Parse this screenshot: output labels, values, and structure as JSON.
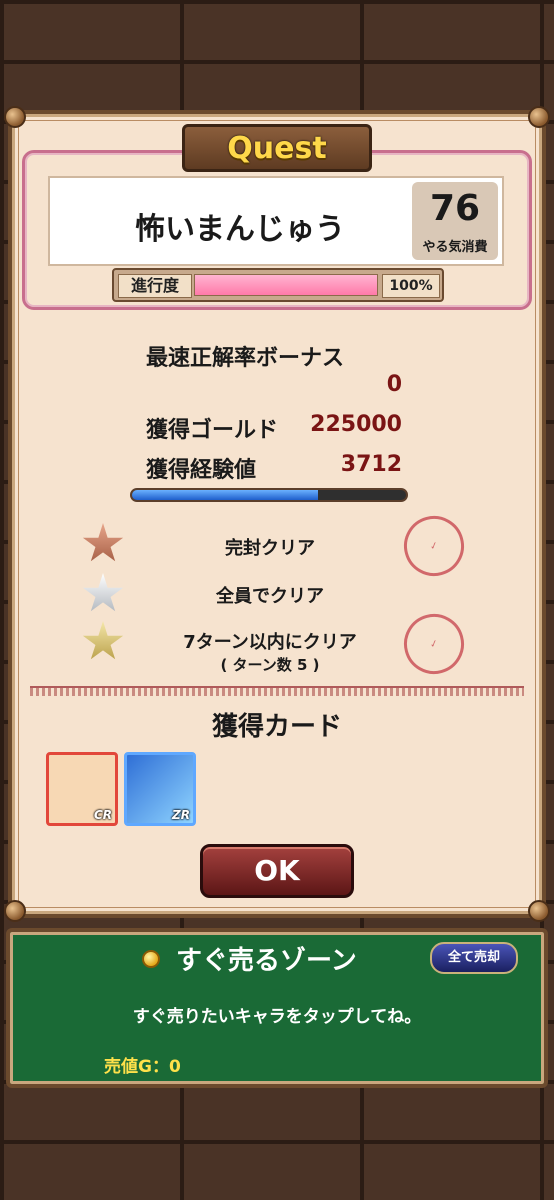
{
  "header": {
    "title": "Quest"
  },
  "quest": {
    "name": "怖いまんじゅう",
    "cost_value": "76",
    "cost_label": "やる気消費",
    "progress_label": "進行度",
    "progress_text": "100%",
    "progress_fraction": 1.0
  },
  "results": {
    "bonus_label": "最速正解率ボーナス",
    "bonus_value": "0",
    "gold_label": "獲得ゴールド",
    "gold_value": "225000",
    "exp_label": "獲得経験値",
    "exp_value": "3712",
    "exp_fraction": 0.68
  },
  "missions": [
    {
      "label": "完封クリア",
      "star": "bronze-star-icon",
      "cleared": true
    },
    {
      "label": "全員でクリア",
      "star": "silver-star-icon",
      "cleared": false
    },
    {
      "label": "7ターン以内にクリア",
      "sub": "( ターン数         5 )",
      "star": "gold-star-icon",
      "cleared": true
    }
  ],
  "cards": {
    "heading": "獲得カード",
    "items": [
      {
        "rarity": "CR"
      },
      {
        "rarity": "ZR"
      }
    ]
  },
  "actions": {
    "ok_label": "OK"
  },
  "sell_zone": {
    "title": "すぐ売るゾーン",
    "sell_all_label": "全て売却",
    "hint": "すぐ売りたいキャラをタップしてね。",
    "value_text": "売値G：0"
  },
  "colors": {
    "panel_bg": "#f6e3cf",
    "accent_gold": "#ffd84a",
    "value_red": "#7a1414",
    "sell_green": "#1a6a36"
  }
}
